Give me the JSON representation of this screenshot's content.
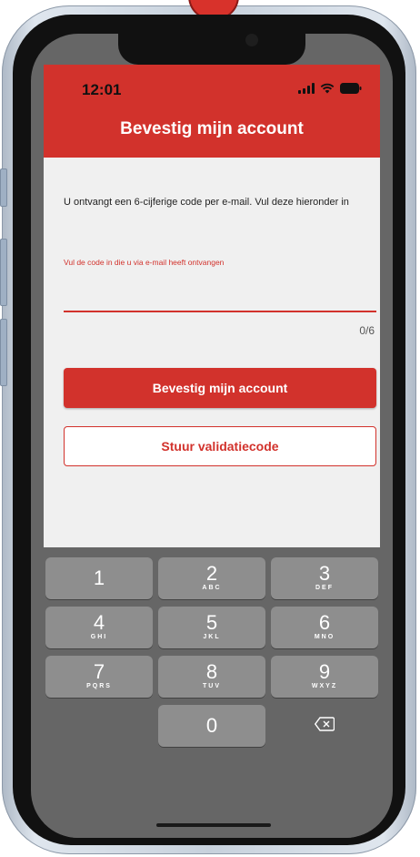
{
  "status_bar": {
    "time": "12:01",
    "icons": [
      "signal-icon",
      "wifi-icon",
      "battery-icon"
    ]
  },
  "header": {
    "title": "Bevestig mijn account",
    "background_color": "#d2322c"
  },
  "content": {
    "instruction": "U ontvangt een 6-cijferige code per e-mail. Vul deze hieronder in",
    "code_field": {
      "label": "Vul de code in die u via e-mail heeft ontvangen",
      "value": "",
      "counter": "0/6"
    },
    "confirm_button_label": "Bevestig mijn account",
    "resend_button_label": "Stuur validatiecode"
  },
  "keypad": {
    "keys": [
      {
        "digit": "1",
        "letters": ""
      },
      {
        "digit": "2",
        "letters": "ABC"
      },
      {
        "digit": "3",
        "letters": "DEF"
      },
      {
        "digit": "4",
        "letters": "GHI"
      },
      {
        "digit": "5",
        "letters": "JKL"
      },
      {
        "digit": "6",
        "letters": "MNO"
      },
      {
        "digit": "7",
        "letters": "PQRS"
      },
      {
        "digit": "8",
        "letters": "TUV"
      },
      {
        "digit": "9",
        "letters": "WXYZ"
      },
      {
        "digit": "0",
        "letters": ""
      }
    ],
    "delete_icon": "delete-backspace-icon"
  },
  "colors": {
    "accent": "#d2322c",
    "app_background": "#f0f0f0",
    "keypad_background": "#666666",
    "key_background": "#8e8e8e"
  }
}
